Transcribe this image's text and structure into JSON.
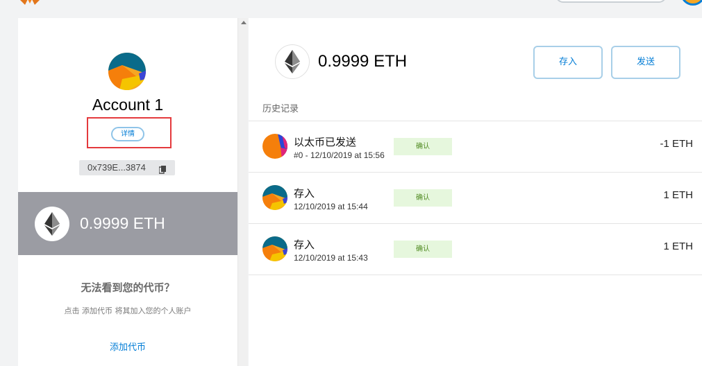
{
  "top": {
    "logo_icon": "fox-logo-icon",
    "avatar_icon": "identicon-avatar"
  },
  "account": {
    "name": "Account 1",
    "details_label": "详情",
    "address": "0x739E...3874",
    "copy_icon": "copy-icon",
    "balance": "0.9999 ETH"
  },
  "tokens": {
    "heading": "无法看到您的代币？",
    "hint": "点击 添加代币 将其加入您的个人账户",
    "add_label": "添加代币"
  },
  "main": {
    "balance": "0.9999 ETH",
    "deposit_label": "存入",
    "send_label": "发送",
    "history_label": "历史记录"
  },
  "transactions": [
    {
      "title": "以太币已发送",
      "subtitle": "#0 - 12/10/2019 at 15:56",
      "status": "确认",
      "amount": "-1 ETH"
    },
    {
      "title": "存入",
      "subtitle": "12/10/2019 at 15:44",
      "status": "确认",
      "amount": "1 ETH"
    },
    {
      "title": "存入",
      "subtitle": "12/10/2019 at 15:43",
      "status": "确认",
      "amount": "1 ETH"
    }
  ],
  "colors": {
    "accent": "#037dd6",
    "balance_card": "#9b9ca3",
    "status_bg": "#e6f7dd",
    "status_text": "#4f8a20",
    "highlight_box": "#e4393c"
  }
}
